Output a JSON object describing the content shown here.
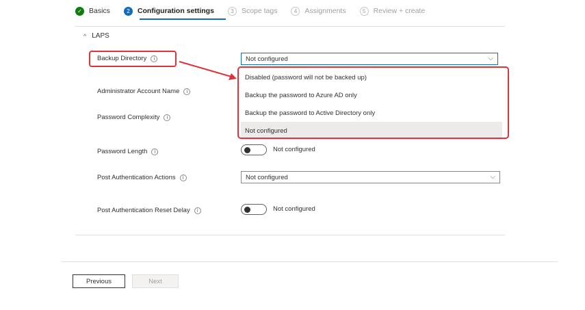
{
  "wizard": {
    "steps": [
      {
        "label": "Basics",
        "marker": "✓",
        "state": "done"
      },
      {
        "label": "Configuration settings",
        "marker": "2",
        "state": "active"
      },
      {
        "label": "Scope tags",
        "marker": "3",
        "state": "todo"
      },
      {
        "label": "Assignments",
        "marker": "4",
        "state": "todo"
      },
      {
        "label": "Review + create",
        "marker": "5",
        "state": "todo"
      }
    ]
  },
  "section": {
    "title": "LAPS",
    "chevron": "^"
  },
  "fields": {
    "backup_directory": {
      "label": "Backup Directory",
      "value": "Not configured"
    },
    "admin_account_name": {
      "label": "Administrator Account Name"
    },
    "password_complexity": {
      "label": "Password Complexity"
    },
    "password_length": {
      "label": "Password Length",
      "value": "Not configured"
    },
    "post_auth_actions": {
      "label": "Post Authentication Actions",
      "value": "Not configured"
    },
    "post_auth_reset_delay": {
      "label": "Post Authentication Reset Delay",
      "value": "Not configured"
    }
  },
  "dropdown_options": [
    "Disabled (password will not be backed up)",
    "Backup the password to Azure AD only",
    "Backup the password to Active Directory only",
    "Not configured"
  ],
  "selected_option_index": 3,
  "info_glyph": "i",
  "caret_glyph": "⌵",
  "footer": {
    "previous": "Previous",
    "next": "Next"
  },
  "colors": {
    "accent": "#0f6cbd",
    "success": "#107c10",
    "callout": "#e0323a"
  }
}
